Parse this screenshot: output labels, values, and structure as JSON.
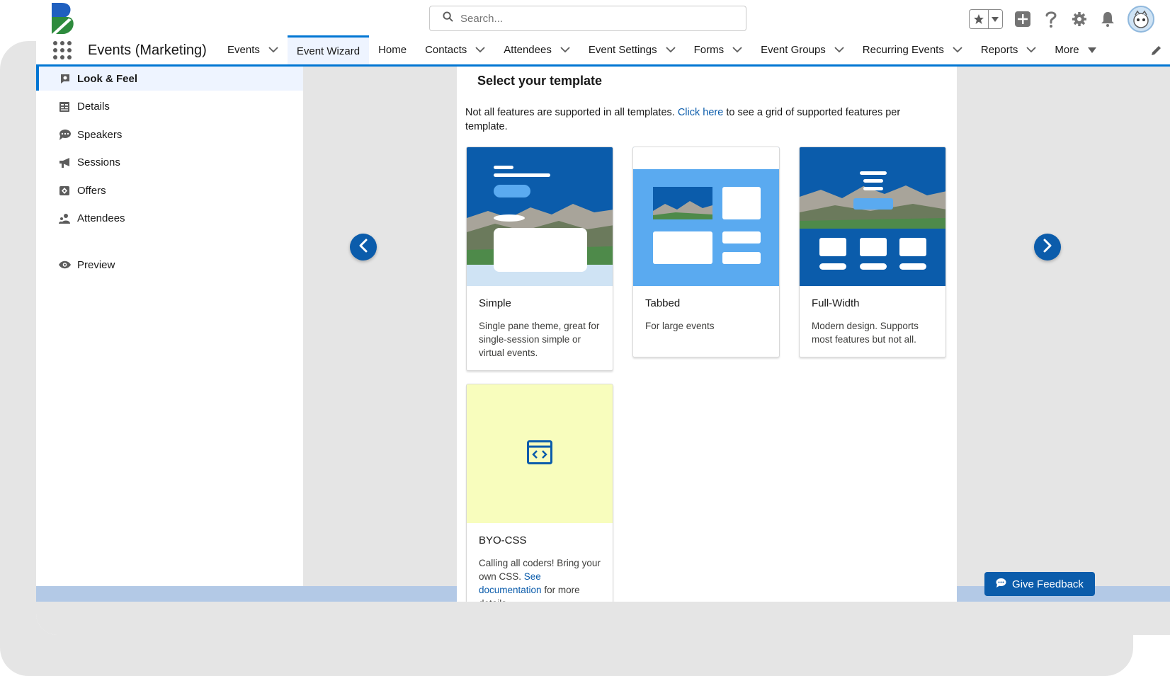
{
  "header": {
    "search_placeholder": "Search..."
  },
  "nav": {
    "app_name": "Events (Marketing)",
    "tabs": [
      {
        "label": "Events",
        "dropdown": true
      },
      {
        "label": "Event Wizard",
        "dropdown": false,
        "active": true
      },
      {
        "label": "Home",
        "dropdown": false
      },
      {
        "label": "Contacts",
        "dropdown": true
      },
      {
        "label": "Attendees",
        "dropdown": true
      },
      {
        "label": "Event Settings",
        "dropdown": true
      },
      {
        "label": "Forms",
        "dropdown": true
      },
      {
        "label": "Event Groups",
        "dropdown": true
      },
      {
        "label": "Recurring Events",
        "dropdown": true
      },
      {
        "label": "Reports",
        "dropdown": true
      },
      {
        "label": "More",
        "dropdown": true
      }
    ]
  },
  "sidebar": {
    "items": [
      {
        "label": "Look & Feel",
        "icon": "palette-icon",
        "active": true
      },
      {
        "label": "Details",
        "icon": "details-icon"
      },
      {
        "label": "Speakers",
        "icon": "speakers-icon"
      },
      {
        "label": "Sessions",
        "icon": "megaphone-icon"
      },
      {
        "label": "Offers",
        "icon": "offers-icon"
      },
      {
        "label": "Attendees",
        "icon": "attendees-icon"
      }
    ],
    "preview_label": "Preview"
  },
  "panel": {
    "title": "Select your template",
    "desc_before": "Not all features are supported in all templates. ",
    "desc_link": "Click here",
    "desc_after": " to see a grid of supported features per template."
  },
  "templates": [
    {
      "name": "Simple",
      "desc": "Single pane theme, great for single-session simple or virtual events."
    },
    {
      "name": "Tabbed",
      "desc": "For large events"
    },
    {
      "name": "Full-Width",
      "desc": "Modern design. Supports most features but not all."
    },
    {
      "name": "BYO-CSS",
      "desc_before": "Calling all coders! Bring your own CSS. ",
      "desc_link": "See documentation",
      "desc_after": " for more details."
    }
  ],
  "feedback_label": "Give Feedback",
  "colors": {
    "brand_blue": "#0b5cab",
    "accent_blue": "#0176d3",
    "light_blue": "#5aaaf0",
    "byo_yellow": "#f8fdbd"
  }
}
